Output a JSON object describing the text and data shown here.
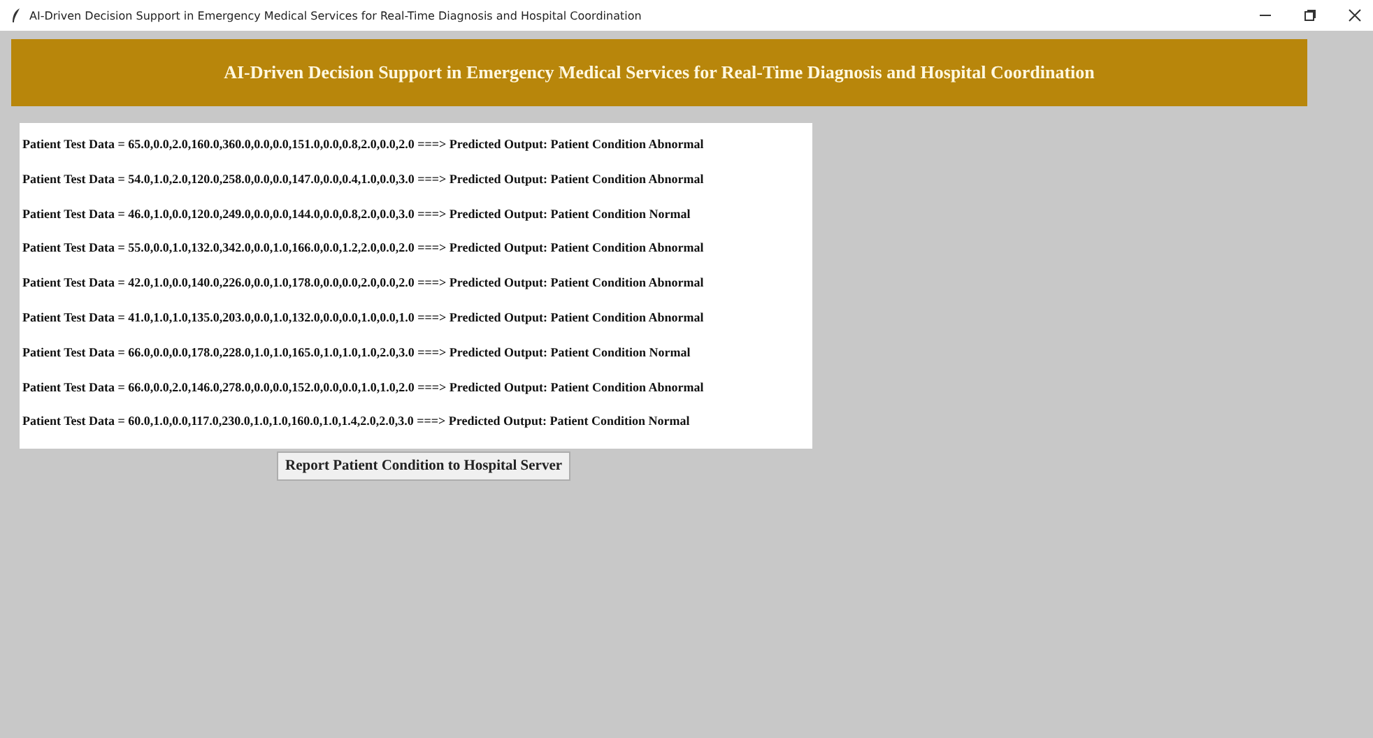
{
  "window": {
    "title": "AI-Driven Decision Support in Emergency Medical Services for Real-Time Diagnosis and Hospital Coordination"
  },
  "header": {
    "title": "AI-Driven Decision Support in Emergency Medical Services for Real-Time Diagnosis and Hospital Coordination"
  },
  "results": [
    "Patient Test Data = 65.0,0.0,2.0,160.0,360.0,0.0,0.0,151.0,0.0,0.8,2.0,0.0,2.0 ===> Predicted Output: Patient Condition Abnormal",
    "Patient Test Data = 54.0,1.0,2.0,120.0,258.0,0.0,0.0,147.0,0.0,0.4,1.0,0.0,3.0 ===> Predicted Output: Patient Condition Abnormal",
    "Patient Test Data = 46.0,1.0,0.0,120.0,249.0,0.0,0.0,144.0,0.0,0.8,2.0,0.0,3.0 ===> Predicted Output: Patient Condition Normal",
    "Patient Test Data = 55.0,0.0,1.0,132.0,342.0,0.0,1.0,166.0,0.0,1.2,2.0,0.0,2.0 ===> Predicted Output: Patient Condition Abnormal",
    "Patient Test Data = 42.0,1.0,0.0,140.0,226.0,0.0,1.0,178.0,0.0,0.0,2.0,0.0,2.0 ===> Predicted Output: Patient Condition Abnormal",
    "Patient Test Data = 41.0,1.0,1.0,135.0,203.0,0.0,1.0,132.0,0.0,0.0,1.0,0.0,1.0 ===> Predicted Output: Patient Condition Abnormal",
    "Patient Test Data = 66.0,0.0,0.0,178.0,228.0,1.0,1.0,165.0,1.0,1.0,1.0,2.0,3.0 ===> Predicted Output: Patient Condition Normal",
    "Patient Test Data = 66.0,0.0,2.0,146.0,278.0,0.0,0.0,152.0,0.0,0.0,1.0,1.0,2.0 ===> Predicted Output: Patient Condition Abnormal",
    "Patient Test Data = 60.0,1.0,0.0,117.0,230.0,1.0,1.0,160.0,1.0,1.4,2.0,2.0,3.0 ===> Predicted Output: Patient Condition Normal"
  ],
  "buttons": [
    "Report Patient Condition to Hospital Server"
  ]
}
